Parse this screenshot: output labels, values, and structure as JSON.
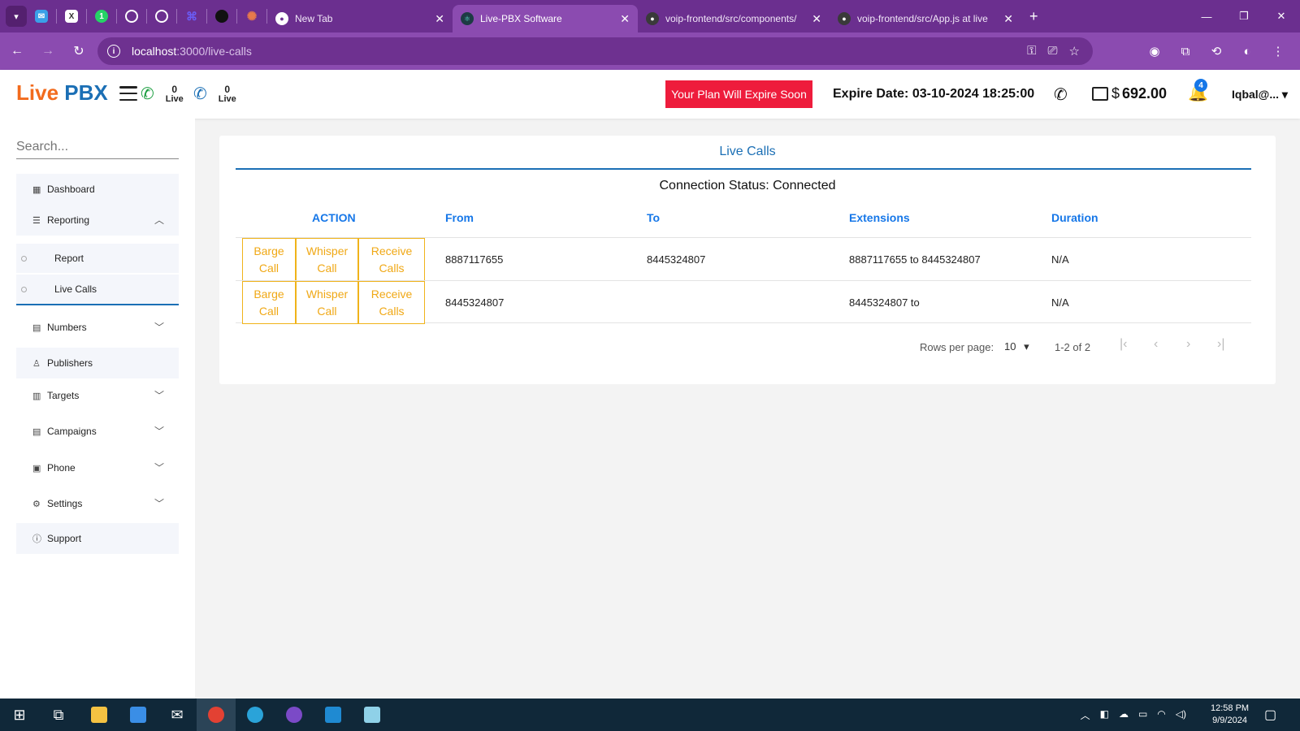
{
  "browser": {
    "tabs": [
      {
        "label": "New Tab",
        "active": false
      },
      {
        "label": "Live-PBX Software",
        "active": true
      },
      {
        "label": "voip-frontend/src/components/",
        "active": false
      },
      {
        "label": "voip-frontend/src/App.js at live",
        "active": false
      }
    ],
    "url_host": "localhost",
    "url_path": ":3000/live-calls"
  },
  "header": {
    "logo_part1": "Live",
    "logo_part2": "PBX",
    "live_a_count": "0",
    "live_a_label": "Live",
    "live_b_count": "0",
    "live_b_label": "Live",
    "expire_button": "Your Plan Will Expire Soon",
    "expire_date": "Expire Date: 03-10-2024 18:25:00",
    "currency": "$",
    "balance": "692.00",
    "notification_count": "4",
    "user": "Iqbal@..."
  },
  "sidebar": {
    "search_placeholder": "Search...",
    "items": [
      {
        "label": "Dashboard",
        "icon": "dashboard-icon"
      },
      {
        "label": "Reporting",
        "icon": "reporting-icon",
        "expanded": true
      },
      {
        "label": "Report",
        "sub": true
      },
      {
        "label": "Live Calls",
        "sub": true,
        "active": true
      },
      {
        "label": "Numbers",
        "icon": "numbers-icon"
      },
      {
        "label": "Publishers",
        "icon": "user-icon"
      },
      {
        "label": "Targets",
        "icon": "targets-icon"
      },
      {
        "label": "Campaigns",
        "icon": "campaigns-icon"
      },
      {
        "label": "Phone",
        "icon": "phone-icon"
      },
      {
        "label": "Settings",
        "icon": "gear-icon"
      },
      {
        "label": "Support",
        "icon": "info-icon"
      }
    ]
  },
  "live_calls": {
    "title": "Live Calls",
    "connection_status": "Connection Status: Connected",
    "columns": [
      "ACTION",
      "From",
      "To",
      "Extensions",
      "Duration"
    ],
    "actions": {
      "barge": [
        "Barge",
        "Call"
      ],
      "whisper": [
        "Whisper",
        "Call"
      ],
      "receive": [
        "Receive",
        "Calls"
      ]
    },
    "rows": [
      {
        "from": "8887117655",
        "to": "8445324807",
        "extensions": "8887117655 to 8445324807",
        "duration": "N/A"
      },
      {
        "from": "8445324807",
        "to": "",
        "extensions": "8445324807 to",
        "duration": "N/A"
      }
    ],
    "pagination": {
      "rows_per_page_label": "Rows per page:",
      "rows_per_page": "10",
      "range": "1-2 of 2"
    }
  },
  "taskbar": {
    "time": "12:58 PM",
    "date": "9/9/2024"
  },
  "colors": {
    "browser_purple": "#6b2f8f",
    "accent_blue": "#1b6fb5",
    "logo_orange": "#f26b1d",
    "expire_red": "#ee1c3c",
    "action_amber": "#f0a815"
  }
}
